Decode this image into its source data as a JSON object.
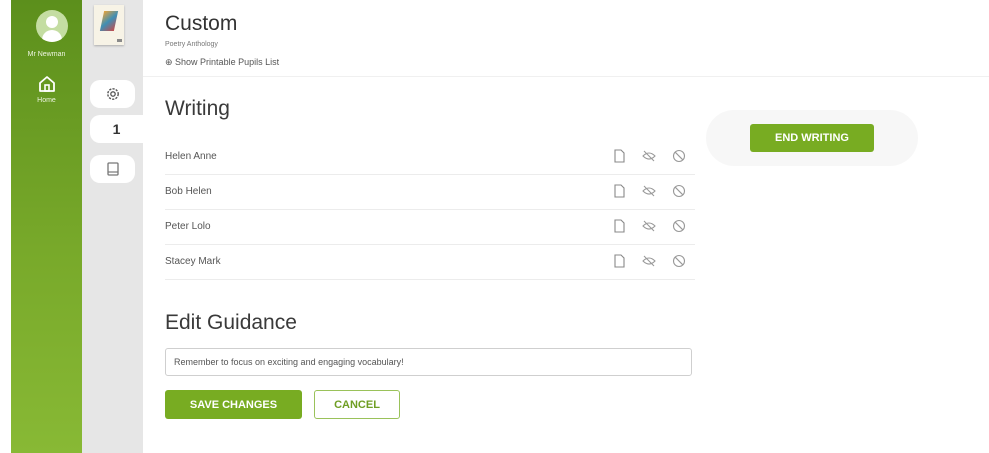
{
  "sidebar": {
    "user_name": "Mr Newman",
    "home_label": "Home"
  },
  "tabs": {
    "active_label": "1"
  },
  "header": {
    "title": "Custom",
    "subtitle": "Poetry Anthology",
    "print_link": "⊕ Show Printable Pupils List"
  },
  "writing": {
    "title": "Writing",
    "pupils": [
      {
        "name": "Helen Anne"
      },
      {
        "name": "Bob Helen"
      },
      {
        "name": "Peter Lolo"
      },
      {
        "name": "Stacey Mark"
      }
    ],
    "end_button": "END WRITING"
  },
  "guidance": {
    "title": "Edit Guidance",
    "value": "Remember to focus on exciting and engaging vocabulary!",
    "save_button": "SAVE CHANGES",
    "cancel_button": "CANCEL"
  },
  "colors": {
    "accent_green": "#78ac22",
    "sidebar_green": "#6a9e22"
  },
  "icons": {
    "row_icons": [
      "document-icon",
      "hidden-eye-icon",
      "block-icon"
    ],
    "tabs": [
      "gear-icon",
      "book-icon"
    ],
    "nav": [
      "home-icon",
      "user-avatar-icon"
    ]
  }
}
